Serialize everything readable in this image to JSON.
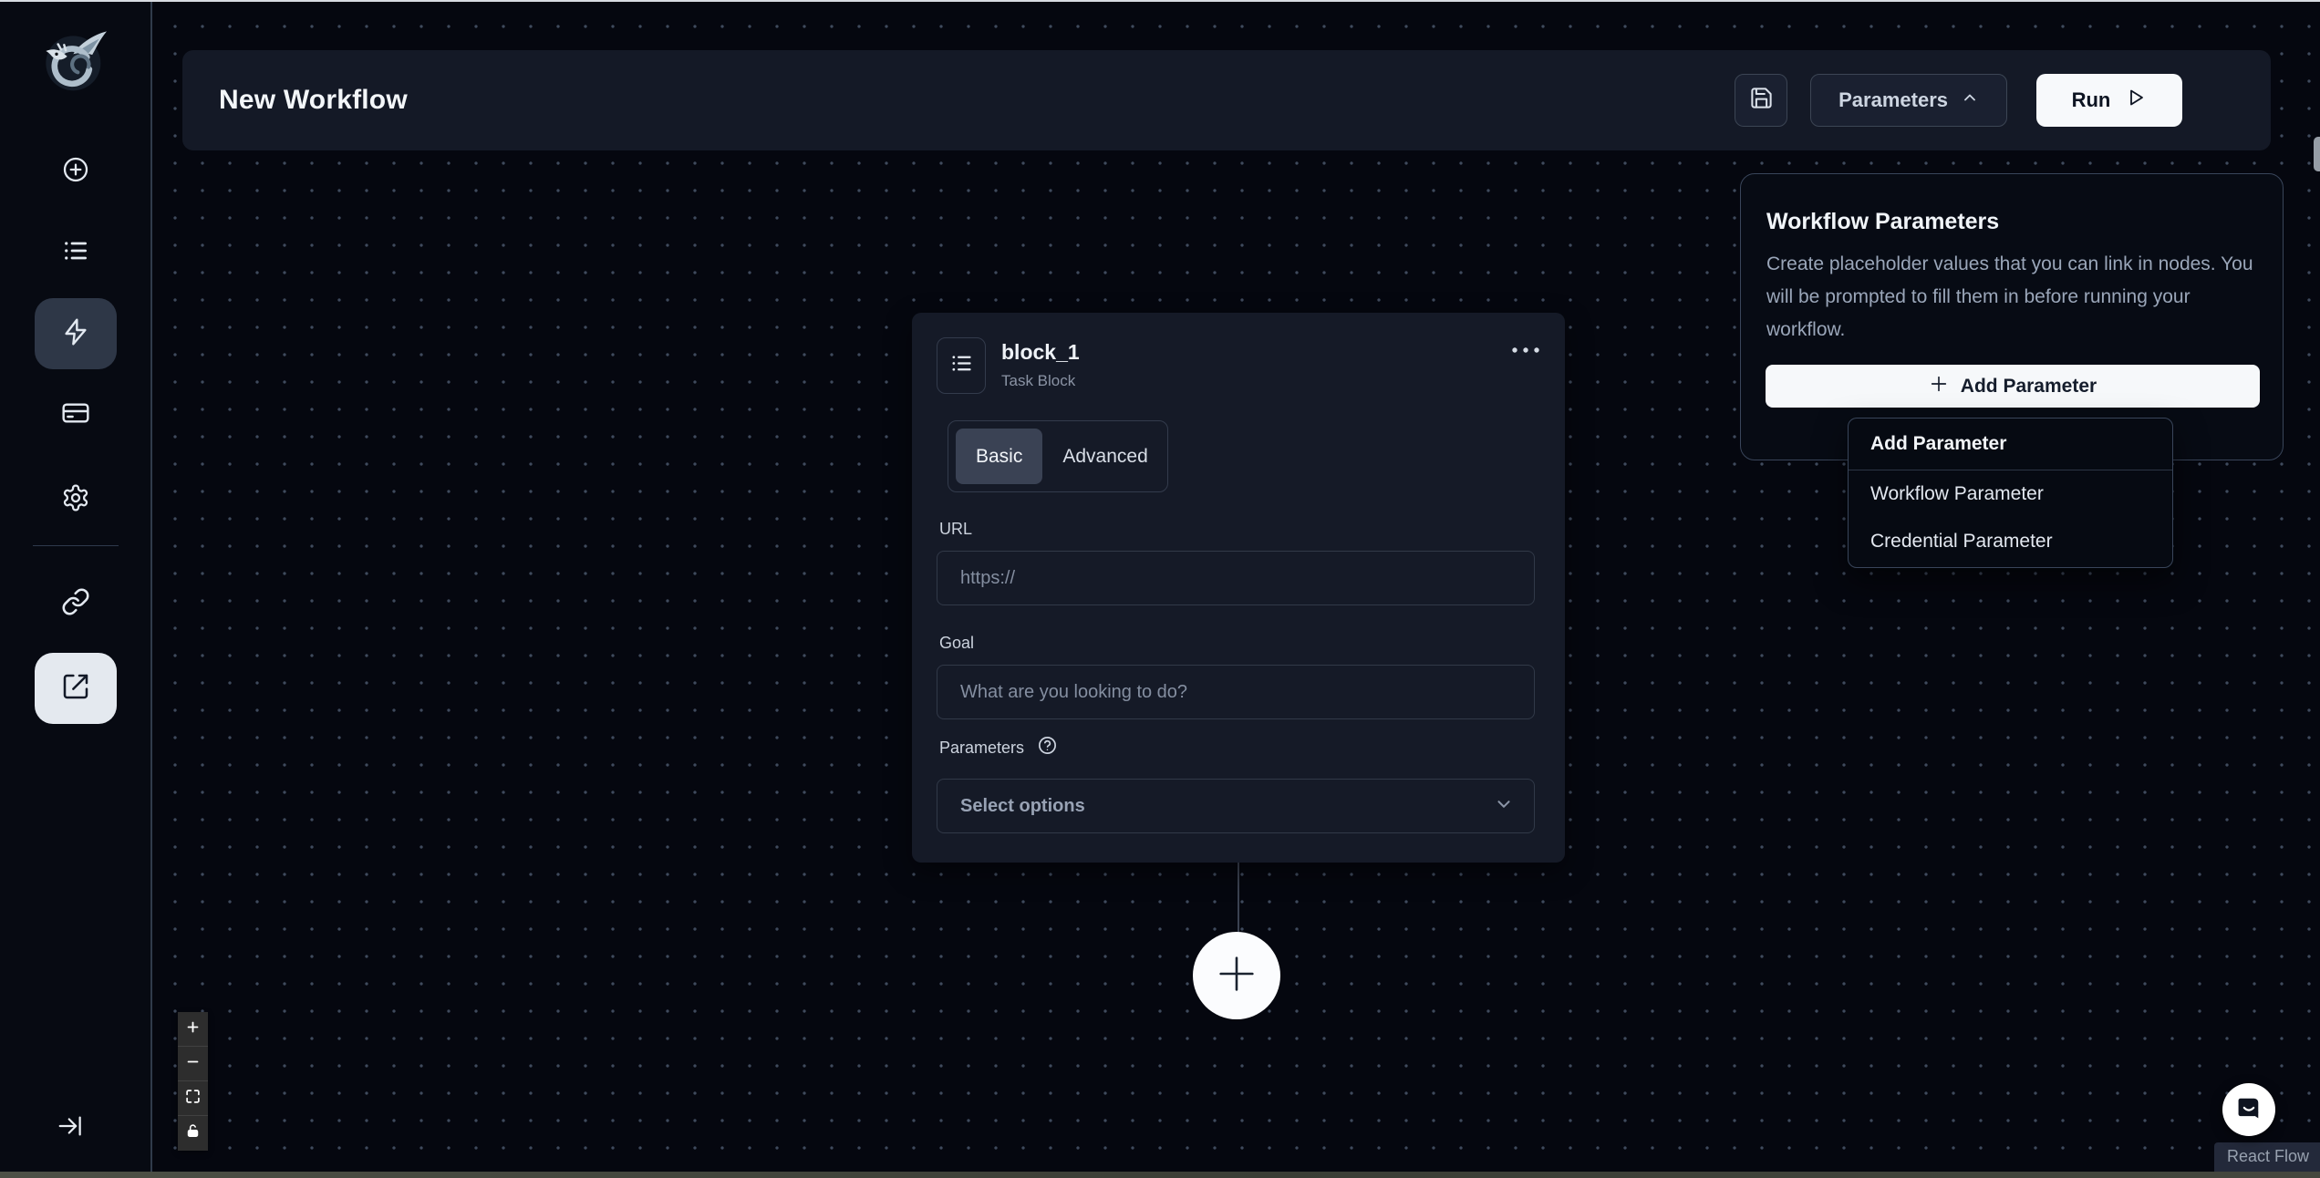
{
  "header": {
    "title": "New Workflow",
    "parameters_label": "Parameters",
    "run_label": "Run"
  },
  "block": {
    "name": "block_1",
    "type": "Task Block",
    "tabs": [
      "Basic",
      "Advanced"
    ],
    "url_label": "URL",
    "url_placeholder": "https://",
    "goal_label": "Goal",
    "goal_placeholder": "What are you looking to do?",
    "parameters_label": "Parameters",
    "select_placeholder": "Select options"
  },
  "panel": {
    "title": "Workflow Parameters",
    "description": "Create placeholder values that you can link in nodes. You will be prompted to fill them in before running your workflow.",
    "add_button_label": "Add Parameter"
  },
  "dropdown": {
    "header": "Add Parameter",
    "items": [
      "Workflow Parameter",
      "Credential Parameter"
    ]
  },
  "attribution": "React Flow",
  "colors": {
    "canvas_bg": "#05070f",
    "surface": "#141926",
    "card": "#151a27",
    "border": "#333b4c",
    "accent_light": "#f7f9fb",
    "text_primary": "#f1f5f9",
    "text_muted": "#9aa6b9"
  }
}
